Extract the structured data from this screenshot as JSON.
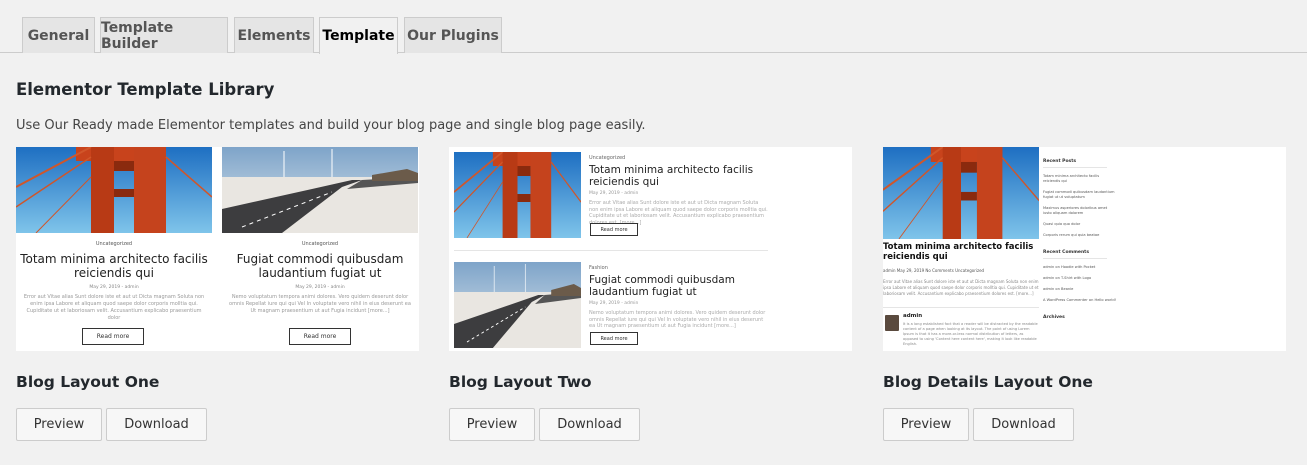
{
  "tabs": [
    {
      "label": "General"
    },
    {
      "label": "Template Builder"
    },
    {
      "label": "Elements"
    },
    {
      "label": "Template",
      "active": true
    },
    {
      "label": "Our Plugins"
    }
  ],
  "page": {
    "title": "Elementor Template Library",
    "description": "Use Our Ready made Elementor templates and build your blog page and single blog page easily."
  },
  "templates": [
    {
      "name": "Blog Layout One",
      "preview_label": "Preview",
      "download_label": "Download",
      "thumb": {
        "cards": [
          {
            "category": "Uncategorized",
            "title": "Totam minima architecto facilis reiciendis qui",
            "meta": "May 29, 2019 - admin",
            "excerpt": "Error aut Vitae alias Sunt dolore iste et aut ut Dicta magnam Soluta non enim ipsa Labore et aliquam quod saepe dolor corporis molltia qui. Cupiditate ut et laboriosam velit. Accusantium explicabo praesentium dolor",
            "read_more": "Read more"
          },
          {
            "category": "Uncategorized",
            "title": "Fugiat commodi quibusdam laudantium fugiat ut",
            "meta": "May 29, 2019 - admin",
            "excerpt": "Nemo voluptatum tempora animi dolores. Vero quidem deserunt dolor omnis Repellat iure qui qui Vel In voluptate vero nihil in eius deserunt ea Ut magnam praesentium ut aut Fugia incidunt [more...]",
            "read_more": "Read more"
          }
        ]
      }
    },
    {
      "name": "Blog Layout Two",
      "preview_label": "Preview",
      "download_label": "Download",
      "thumb": {
        "cards": [
          {
            "category": "Uncategorized",
            "title": "Totam minima architecto facilis reiciendis qui",
            "meta": "May 29, 2019 - admin",
            "excerpt": "Error aut Vitae alias Sunt dolore iste et aut ut Dicta magnam Soluta non enim ipsa Labore et aliquam quod saepe dolor corporis molltia qui. Cupiditate ut et laboriosam velit. Accusantium explicabo praesentium dolores est. [more...]",
            "read_more": "Read more"
          },
          {
            "category": "Fashion",
            "title": "Fugiat commodi quibusdam laudantium fugiat ut",
            "meta": "May 29, 2019 - admin",
            "excerpt": "Nemo voluptatum tempora animi dolores. Vero quidem deserunt dolor omnis Repellat iure qui qui Vel In voluptate vero nihil in eius deserunt ea Ut magnam praesentium ut aut Fugia incidunt [more...]",
            "read_more": "Read more"
          }
        ]
      }
    },
    {
      "name": "Blog Details Layout One",
      "preview_label": "Preview",
      "download_label": "Download",
      "thumb": {
        "post_title": "Totam minima architecto facilis reiciendis qui",
        "post_meta": "admin  May 29, 2019  No Comments  Uncategorized",
        "post_excerpt": "Error aut Vitae alias Sunt dolore iste et aut ut Dicta magnam Soluta non enim ipsa Labore et aliquam quod saepe dolor corporis molltia qui. Cupiditate ut et laboriosam velit. Accusantium explicabo praesentium dolores est. [more...]",
        "author_name": "admin",
        "author_bio": "It is a long established fact that a reader will be distracted by the readable content of a page when looking at its layout. The point of using Lorem Ipsum is that it has a more-or-less normal distribution of letters, as opposed to using 'Content here content here', making it look like readable English.",
        "sidebar": {
          "recent_posts_title": "Recent Posts",
          "recent_posts": [
            "Totam minima architecto facilis reiciendis qui",
            "Fugiat commodi quibusdam laudantium fugiat ut ut voluptatum",
            "Maximus asperiores doloribus amet iusto aliquam dolorem",
            "Quasi quia quo dolor",
            "Corporis rerum qui quia beatae"
          ],
          "recent_comments_title": "Recent Comments",
          "recent_comments": [
            "admin on Hoodie with Pocket",
            "admin on T-Shirt with Logo",
            "admin on Beanie",
            "A WordPress Commenter on Hello world!"
          ],
          "archives_title": "Archives"
        }
      }
    }
  ]
}
